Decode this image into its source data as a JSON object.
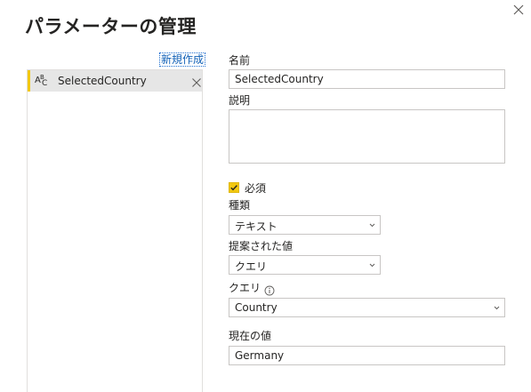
{
  "dialog": {
    "title": "パラメーターの管理"
  },
  "list": {
    "new_link": "新規作成",
    "items": [
      {
        "label": "SelectedCountry",
        "type_icon": "abc-type-icon",
        "selected": true
      }
    ]
  },
  "form": {
    "name_label": "名前",
    "name_value": "SelectedCountry",
    "description_label": "説明",
    "description_value": "",
    "required_label": "必須",
    "required_checked": true,
    "type_label": "種類",
    "type_value": "テキスト",
    "suggested_label": "提案された値",
    "suggested_value": "クエリ",
    "query_label": "クエリ",
    "query_value": "Country",
    "current_label": "現在の値",
    "current_value": "Germany"
  },
  "colors": {
    "accent_yellow": "#f2c811",
    "link_blue": "#0f5fb6",
    "selected_row_bg": "#e6e6e6"
  }
}
